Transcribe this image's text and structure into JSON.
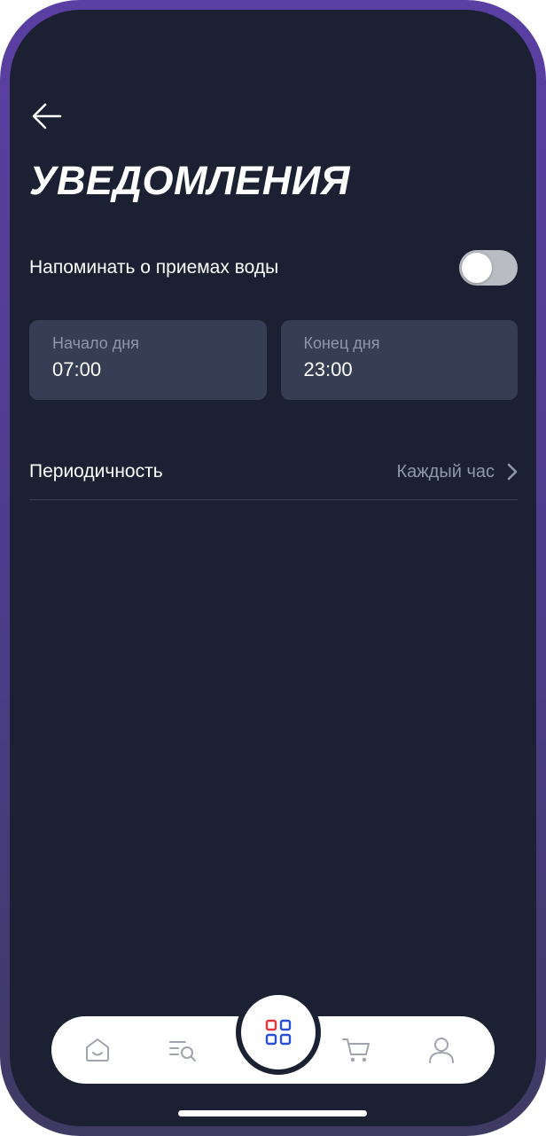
{
  "header": {
    "title": "УВЕДОМЛЕНИЯ",
    "back_icon": "arrow-left-icon"
  },
  "reminder": {
    "label": "Напоминать о приемах воды",
    "enabled": false
  },
  "day_start": {
    "label": "Начало дня",
    "value": "07:00"
  },
  "day_end": {
    "label": "Конец дня",
    "value": "23:00"
  },
  "periodicity": {
    "label": "Периодичность",
    "value": "Каждый час",
    "icon": "chevron-right-icon"
  },
  "tab_bar": {
    "items": [
      {
        "name": "home",
        "icon": "home-icon"
      },
      {
        "name": "search",
        "icon": "search-list-icon"
      },
      {
        "name": "catalog",
        "icon": "grid-icon",
        "active": true
      },
      {
        "name": "cart",
        "icon": "cart-icon"
      },
      {
        "name": "profile",
        "icon": "user-icon"
      }
    ]
  },
  "colors": {
    "background": "#1b2033",
    "card": "#353e54",
    "frame": "#5b3fa3",
    "muted_text": "#8e97ab",
    "toggle_off": "#b9bcc2",
    "grid_red": "#e8323c",
    "grid_blue": "#2a4fd6"
  }
}
